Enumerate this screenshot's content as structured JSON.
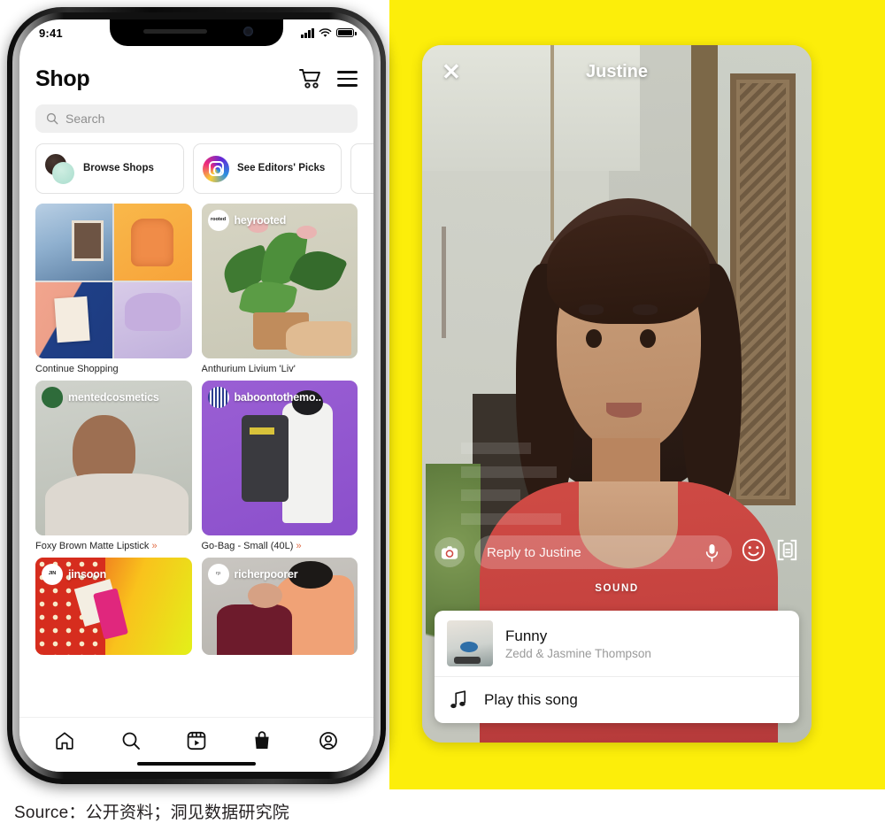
{
  "caption": {
    "text": "Source：公开资料；洞见数据研究院"
  },
  "colors": {
    "yellow": "#FCEE0A",
    "accent_orange": "#E2704A",
    "shirt_red": "#CF4B45"
  },
  "left_phone": {
    "status": {
      "time": "9:41",
      "signal_icon": "cellular-bars-icon",
      "wifi_icon": "wifi-icon",
      "battery_icon": "battery-icon"
    },
    "header": {
      "title": "Shop",
      "cart_icon": "shopping-cart-icon",
      "menu_icon": "hamburger-menu-icon"
    },
    "search": {
      "placeholder": "Search",
      "icon": "search-icon"
    },
    "chips": [
      {
        "label": "Browse Shops",
        "icon": "shop-avatars-icon"
      },
      {
        "label": "See Editors' Picks",
        "icon": "instagram-icon"
      },
      {
        "label": "",
        "icon": "partial-card-icon"
      }
    ],
    "grid": [
      [
        {
          "brand": "",
          "label": "Continue Shopping",
          "chevron": "",
          "kind": "collage"
        },
        {
          "brand": "heyrooted",
          "label": "Anthurium Livium 'Liv'",
          "chevron": "",
          "kind": "plant"
        }
      ],
      [
        {
          "brand": "mentedcosmetics",
          "label": "Foxy Brown Matte Lipstick",
          "chevron": "»",
          "kind": "cosmetics"
        },
        {
          "brand": "baboontothemo..",
          "label": "Go-Bag - Small (40L)",
          "chevron": "»",
          "kind": "backpack"
        }
      ],
      [
        {
          "brand": "jinsoon",
          "label": "",
          "chevron": "",
          "kind": "nailpolish"
        },
        {
          "brand": "richerpoorer",
          "label": "",
          "chevron": "",
          "kind": "apparel"
        }
      ]
    ],
    "tabbar": [
      {
        "name": "home-tab",
        "icon": "home-icon"
      },
      {
        "name": "search-tab",
        "icon": "search-icon"
      },
      {
        "name": "reels-tab",
        "icon": "reels-icon"
      },
      {
        "name": "shop-tab",
        "icon": "shopping-bag-icon"
      },
      {
        "name": "profile-tab",
        "icon": "profile-icon"
      }
    ]
  },
  "right_phone": {
    "topbar": {
      "close_label": "✕",
      "username": "Justine"
    },
    "reply": {
      "camera_icon": "camera-icon",
      "placeholder": "Reply to Justine",
      "mic_icon": "microphone-icon",
      "emoji_icon": "smiley-icon",
      "sticker_icon": "sticker-icon"
    },
    "sound_label": "SOUND",
    "song": {
      "title": "Funny",
      "artist": "Zedd & Jasmine Thompson",
      "play_label": "Play this song",
      "note_icon": "music-note-icon",
      "album_art_icon": "album-art-icon"
    }
  }
}
